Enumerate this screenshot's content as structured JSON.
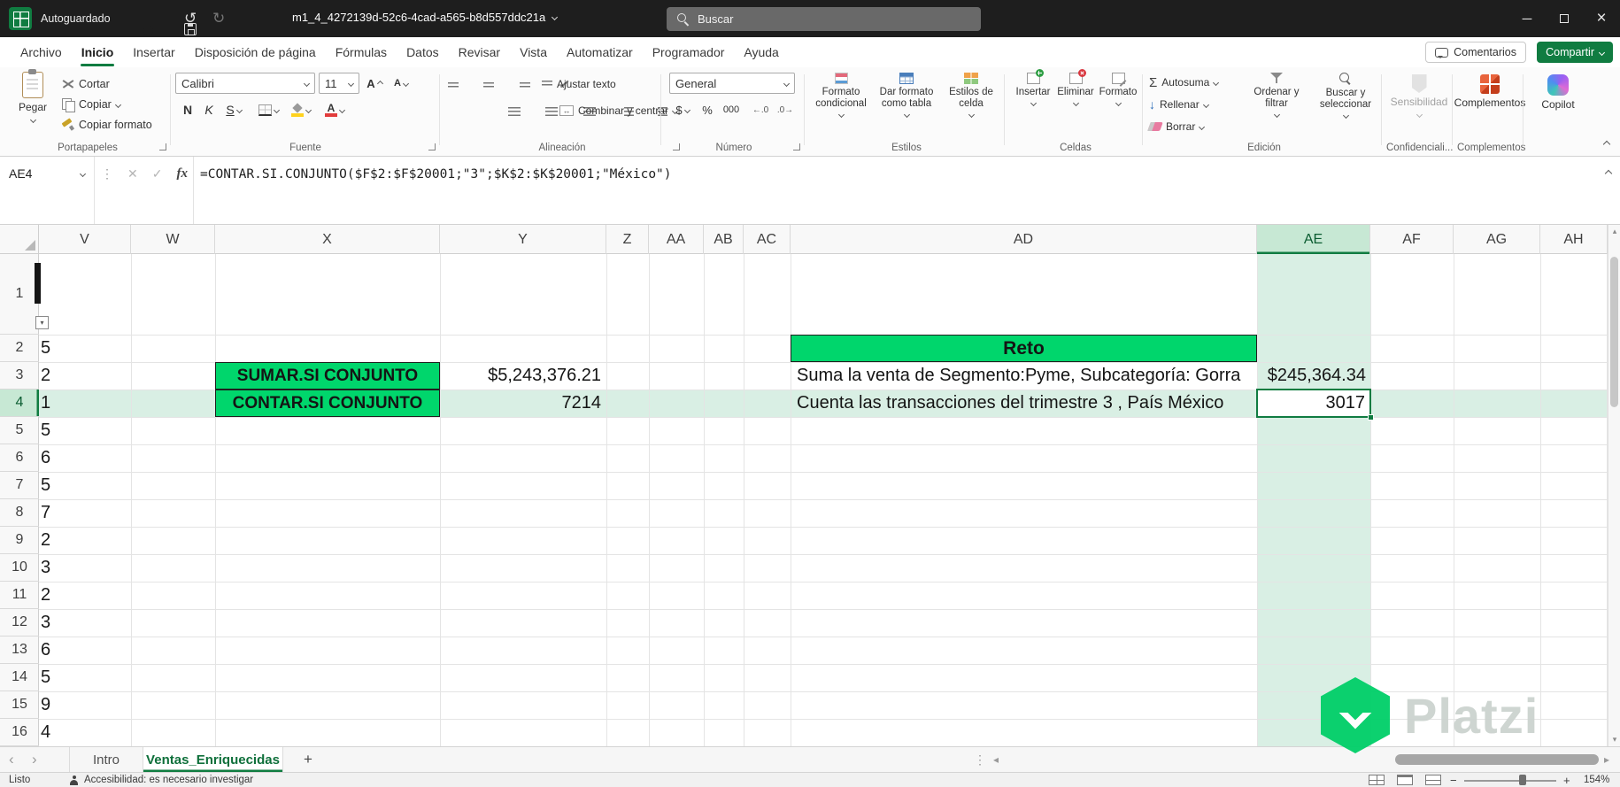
{
  "titlebar": {
    "autosave": "Autoguardado",
    "filename": "m1_4_4272139d-52c6-4cad-a565-b8d557ddc21a",
    "search": "Buscar"
  },
  "menubar": {
    "items": [
      "Archivo",
      "Inicio",
      "Insertar",
      "Disposición de página",
      "Fórmulas",
      "Datos",
      "Revisar",
      "Vista",
      "Automatizar",
      "Programador",
      "Ayuda"
    ],
    "active": "Inicio",
    "comments": "Comentarios",
    "share": "Compartir"
  },
  "ribbon": {
    "clipboard": {
      "paste": "Pegar",
      "cut": "Cortar",
      "copy": "Copiar",
      "format_painter": "Copiar formato",
      "label": "Portapapeles"
    },
    "font": {
      "name": "Calibri",
      "size": "11",
      "bold": "N",
      "italic": "K",
      "underline": "S",
      "letter": "A",
      "label": "Fuente"
    },
    "alignment": {
      "wrap": "Ajustar texto",
      "merge": "Combinar y centrar",
      "merge_arrows": "↔",
      "label": "Alineación"
    },
    "number": {
      "format": "General",
      "currency": "$",
      "percent": "%",
      "thousands": "000",
      "dec_inc": "←.0",
      "dec_dec": ".0→",
      "label": "Número"
    },
    "styles": {
      "conditional": "Formato condicional",
      "table": "Dar formato como tabla",
      "cell": "Estilos de celda",
      "label": "Estilos"
    },
    "cells": {
      "insert": "Insertar",
      "delete": "Eliminar",
      "format": "Formato",
      "label": "Celdas"
    },
    "editing": {
      "autosum": "Autosuma",
      "autosum_symbol": "Σ",
      "fill": "Rellenar",
      "fill_arrow": "↓",
      "clear": "Borrar",
      "sort": "Ordenar y filtrar",
      "find": "Buscar y seleccionar",
      "label": "Edición"
    },
    "sensitivity": {
      "button": "Sensibilidad",
      "label": "Confidenciali..."
    },
    "addins": {
      "button": "Complementos",
      "label": "Complementos"
    },
    "copilot": {
      "button": "Copilot"
    }
  },
  "formula_bar": {
    "name_box": "AE4",
    "cancel": "✕",
    "enter": "✓",
    "fx": "fx",
    "formula": "=CONTAR.SI.CONJUNTO($F$2:$F$20001;\"3\";$K$2:$K$20001;\"México\")"
  },
  "grid": {
    "columns": [
      "V",
      "W",
      "X",
      "Y",
      "Z",
      "AA",
      "AB",
      "AC",
      "AD",
      "AE",
      "AF",
      "AG",
      "AH"
    ],
    "rows": [
      "1",
      "2",
      "3",
      "4",
      "5",
      "6",
      "7",
      "8",
      "9",
      "10",
      "11",
      "12",
      "13",
      "14",
      "15",
      "16"
    ],
    "selected_column": "AE",
    "selected_row": "4",
    "active_cell": "AE4",
    "cells": {
      "x3": "SUMAR.SI CONJUNTO",
      "y3": "$5,243,376.21",
      "x4": "CONTAR.SI CONJUNTO",
      "y4": "7214",
      "ad2": "Reto",
      "ad3": "Suma la venta de Segmento:Pyme, Subcategoría: Gorra",
      "ae3": "$245,364.34",
      "ad4": "Cuenta las transacciones del trimestre 3 , País México",
      "ae4": "3017"
    },
    "v_partial": [
      "5",
      "2",
      "1",
      "5",
      "6",
      "5",
      "7",
      "2",
      "3",
      "2",
      "3",
      "6",
      "5",
      "9",
      "4"
    ]
  },
  "sheet_tabs": {
    "tabs": [
      "Intro",
      "Ventas_Enriquecidas"
    ],
    "active": "Ventas_Enriquecidas"
  },
  "status_bar": {
    "mode": "Listo",
    "accessibility": "Accesibilidad: es necesario investigar",
    "zoom": "154%"
  },
  "watermark": {
    "text": "Platzi"
  },
  "icons": {
    "undo": "↺",
    "redo": "↻",
    "minimize": "─",
    "close": "×",
    "dots_vertical": "⋮",
    "nav_prev": "‹",
    "nav_next": "›",
    "arrow_left_small": "◂",
    "arrow_right_small": "▸",
    "arrow_up_small": "▴",
    "arrow_down_small": "▾",
    "plus": "+",
    "minus": "−"
  },
  "colors": {
    "accent_green": "#107c41",
    "highlight_green": "#00d66c",
    "band_green": "#d9efe4",
    "titlebar": "#1e1e1e"
  }
}
